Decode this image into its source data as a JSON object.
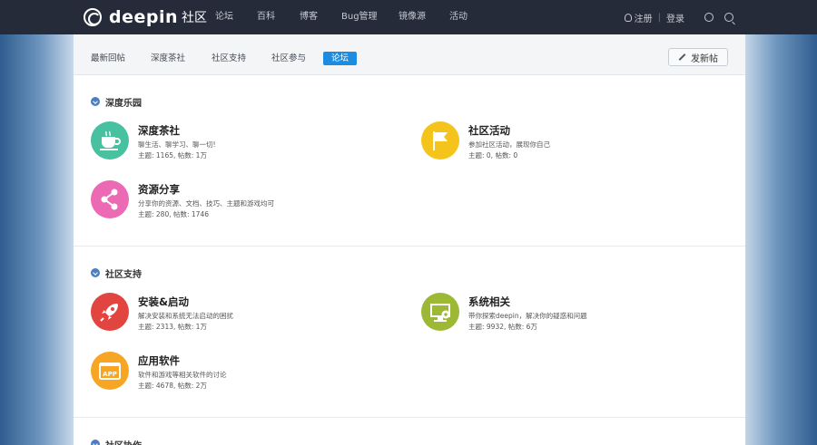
{
  "topbar": {
    "brand": "deepin",
    "brand_sub": "社区",
    "nav": [
      "论坛",
      "百科",
      "博客",
      "Bug管理",
      "镜像源",
      "活动"
    ],
    "register": "注册",
    "separator": "|",
    "login": "登录"
  },
  "subnav": {
    "tabs": [
      "最新回帖",
      "深度茶社",
      "社区支持",
      "社区参与",
      "论坛"
    ],
    "active_tab": "论坛",
    "new_post": "发新帖"
  },
  "sections": [
    {
      "title": "深度乐园",
      "forums": [
        {
          "name": "深度茶社",
          "desc": "聊生活、聊学习、聊一切!",
          "stats": "主题: 1165, 帖数: 1万",
          "icon": "tea-cup-icon",
          "color": "#47c1a0"
        },
        {
          "name": "社区活动",
          "desc": "参加社区活动，展现你自己",
          "stats": "主题: 0, 帖数: 0",
          "icon": "flag-icon",
          "color": "#f5c41c"
        },
        {
          "name": "资源分享",
          "desc": "分享你的资源、文档、技巧、主题和游戏均可",
          "stats": "主题: 280, 帖数: 1746",
          "icon": "share-icon",
          "color": "#ec6ab4"
        }
      ]
    },
    {
      "title": "社区支持",
      "forums": [
        {
          "name": "安装&启动",
          "desc": "解决安装和系统无法启动的困扰",
          "stats": "主题: 2313, 帖数: 1万",
          "icon": "rocket-icon",
          "color": "#e2453f"
        },
        {
          "name": "系统相关",
          "desc": "带你探索deepin，解决你的疑惑和问题",
          "stats": "主题: 9932, 帖数: 6万",
          "icon": "monitor-gear-icon",
          "color": "#9cb834"
        },
        {
          "name": "应用软件",
          "desc": "软件和游戏等相关软件的讨论",
          "stats": "主题: 4678, 帖数: 2万",
          "icon": "app-icon",
          "color": "#f6a623",
          "icon_text": "APP"
        }
      ]
    },
    {
      "title": "社区协作"
    }
  ]
}
